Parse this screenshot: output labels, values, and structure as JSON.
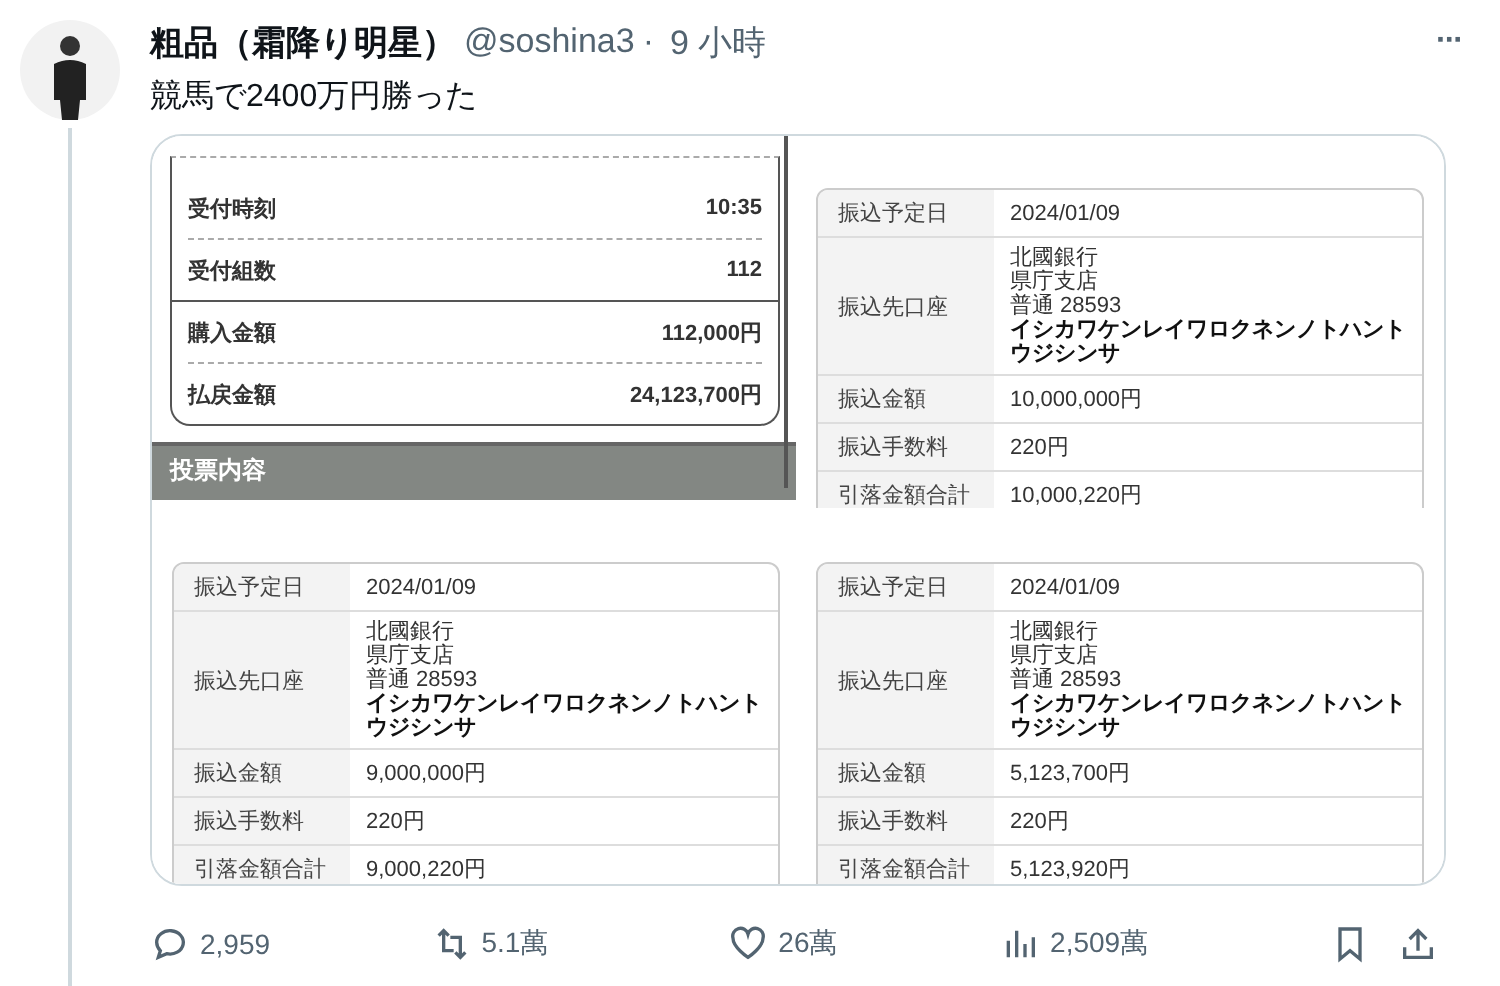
{
  "tweet": {
    "author": "粗品（霜降り明星）",
    "handle": "@soshina3",
    "separator": "·",
    "time": "9 小時",
    "more": "···",
    "text": "競馬で2400万円勝った"
  },
  "media": [
    {
      "kind": "receipt",
      "rows": [
        {
          "label": "受付時刻",
          "value": "10:35",
          "kind": "dashed"
        },
        {
          "label": "受付組数",
          "value": "112",
          "kind": "solid"
        },
        {
          "label": "購入金額",
          "value": "112,000円",
          "kind": "dashed"
        },
        {
          "label": "払戻金額",
          "value": "24,123,700円",
          "kind": "plain"
        }
      ],
      "section": "投票内容"
    },
    {
      "kind": "transfer",
      "rows": [
        {
          "label": "振込予定日",
          "lines": [
            "2024/01/09"
          ]
        },
        {
          "label": "振込先口座",
          "lines": [
            "北國銀行",
            "県庁支店",
            "普通 28593"
          ],
          "account_name": "イシカワケンレイワロクネンノトハントウジシンサ"
        },
        {
          "label": "振込金額",
          "lines": [
            "10,000,000円"
          ]
        },
        {
          "label": "振込手数料",
          "lines": [
            "220円"
          ]
        },
        {
          "label": "引落金額合計",
          "lines": [
            "10,000,220円"
          ]
        }
      ]
    },
    {
      "kind": "transfer",
      "rows": [
        {
          "label": "振込予定日",
          "lines": [
            "2024/01/09"
          ]
        },
        {
          "label": "振込先口座",
          "lines": [
            "北國銀行",
            "県庁支店",
            "普通 28593"
          ],
          "account_name": "イシカワケンレイワロクネンノトハントウジシンサ"
        },
        {
          "label": "振込金額",
          "lines": [
            "9,000,000円"
          ]
        },
        {
          "label": "振込手数料",
          "lines": [
            "220円"
          ]
        },
        {
          "label": "引落金額合計",
          "lines": [
            "9,000,220円"
          ]
        }
      ]
    },
    {
      "kind": "transfer",
      "rows": [
        {
          "label": "振込予定日",
          "lines": [
            "2024/01/09"
          ]
        },
        {
          "label": "振込先口座",
          "lines": [
            "北國銀行",
            "県庁支店",
            "普通 28593"
          ],
          "account_name": "イシカワケンレイワロクネンノトハントウジシンサ"
        },
        {
          "label": "振込金額",
          "lines": [
            "5,123,700円"
          ]
        },
        {
          "label": "振込手数料",
          "lines": [
            "220円"
          ]
        },
        {
          "label": "引落金額合計",
          "lines": [
            "5,123,920円"
          ]
        }
      ]
    }
  ],
  "actions": [
    {
      "kind": "reply",
      "count": "2,959"
    },
    {
      "kind": "repost",
      "count": "5.1萬"
    },
    {
      "kind": "like",
      "count": "26萬"
    },
    {
      "kind": "views",
      "count": "2,509萬"
    },
    {
      "kind": "bookmark"
    },
    {
      "kind": "share"
    }
  ]
}
